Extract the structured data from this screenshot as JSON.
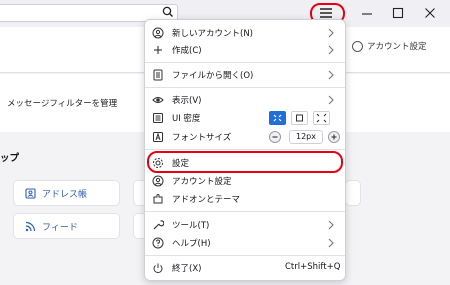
{
  "toolbar": {
    "search_value": ""
  },
  "header": {
    "account_settings_label": "アカウント設定"
  },
  "page": {
    "filter_label": "メッセージフィルターを管理",
    "section_title": "ップ",
    "cards": [
      {
        "label": "アドレス帳",
        "icon": "address-book-icon"
      },
      {
        "label": "フィード",
        "icon": "rss-icon"
      }
    ]
  },
  "menu": {
    "items": {
      "new_account": "新しいアカウント(N)",
      "create": "作成(C)",
      "open_file": "ファイルから開く(O)",
      "view": "表示(V)",
      "ui_density": "UI 密度",
      "font_size": "フォントサイズ",
      "font_size_value": "12px",
      "settings": "設定",
      "account_settings": "アカウント設定",
      "addons_themes": "アドオンとテーマ",
      "tools": "ツール(T)",
      "help": "ヘルプ(H)",
      "quit": "終了(X)",
      "quit_shortcut": "Ctrl+Shift+Q"
    }
  },
  "colors": {
    "highlight": "#e60012",
    "accent": "#1f6fd6",
    "link": "#2a5db0"
  }
}
